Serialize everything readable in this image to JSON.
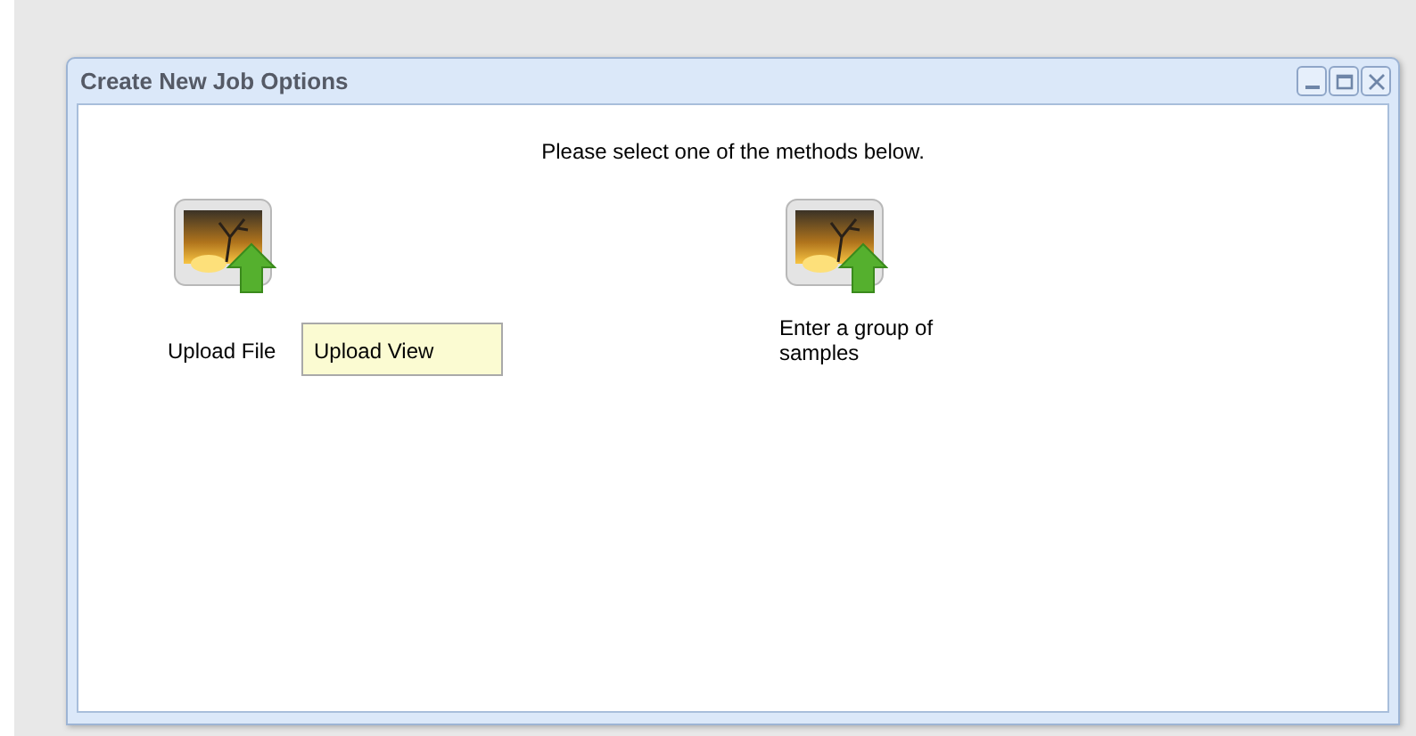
{
  "window": {
    "title": "Create New Job Options"
  },
  "prompt": "Please select one of the methods below.",
  "methods": [
    {
      "label": "Upload File"
    },
    {
      "label": "Enter a group of samples"
    }
  ],
  "tooltip": {
    "text": "Upload View"
  }
}
